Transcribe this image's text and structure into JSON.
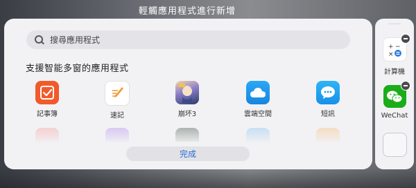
{
  "header": {
    "title": "輕觸應用程式進行新增"
  },
  "search": {
    "placeholder": "搜尋應用程式"
  },
  "section": {
    "title": "支援智能多窗的應用程式"
  },
  "apps": [
    {
      "label": "記事簿",
      "icon": "notes-icon",
      "color": "#f15a2a"
    },
    {
      "label": "速記",
      "icon": "quick-note-icon",
      "color": "#ffffff"
    },
    {
      "label": "崩坏3",
      "icon": "game-icon",
      "color": "#2b3d66"
    },
    {
      "label": "雲端空間",
      "icon": "cloud-icon",
      "color": "#1e9bf0"
    },
    {
      "label": "短訊",
      "icon": "message-icon",
      "color": "#1fa2f2"
    }
  ],
  "ghost_row_colors": [
    "#f7a0a0",
    "#b58cf0",
    "#4a5a4e",
    "#8fc3f0",
    "#f6c080"
  ],
  "done_button": {
    "label": "完成"
  },
  "side_panel": {
    "apps": [
      {
        "label": "計算機",
        "icon": "calculator-icon",
        "color": "#ffffff"
      },
      {
        "label": "WeChat",
        "icon": "wechat-icon",
        "color": "#1aad19"
      }
    ]
  }
}
